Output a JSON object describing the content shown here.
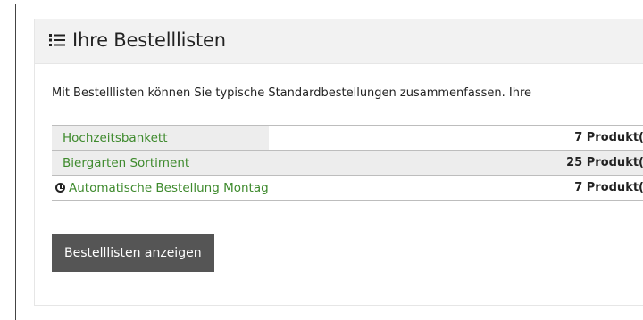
{
  "card": {
    "title": "Ihre Bestelllisten",
    "icon": "list-icon",
    "intro": "Mit Bestelllisten können Sie typische Standardbestellungen zusammenfassen. Ihre"
  },
  "lists": [
    {
      "name": "Hochzeitsbankett",
      "count": "7 Produkt(",
      "scheduled": false
    },
    {
      "name": "Biergarten Sortiment",
      "count": "25 Produkt(",
      "scheduled": false
    },
    {
      "name": "Automatische Bestellung Montag",
      "count": "7 Produkt(",
      "scheduled": true,
      "icon": "clock-icon"
    }
  ],
  "actions": {
    "show_lists_label": "Bestelllisten anzeigen"
  },
  "colors": {
    "link": "#3e8a2d",
    "header_bg": "#f2f2f2",
    "button_bg": "#555555"
  }
}
